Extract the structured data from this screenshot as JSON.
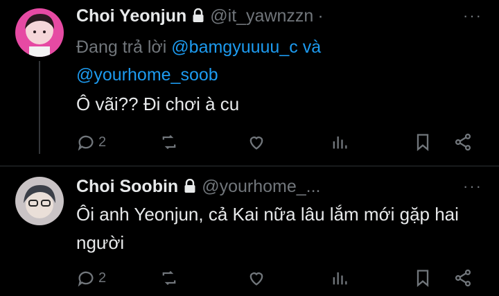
{
  "tweets": [
    {
      "name": "Choi Yeonjun",
      "handle": "@it_yawnzzn",
      "separator": "·",
      "more": "···",
      "reply_prefix": "Đang trả lời",
      "reply_mention_1": "@bamgyuuuu_c",
      "reply_conj": "và",
      "reply_mention_2": "@yourhome_soob",
      "text": "Ô vãi?? Đi chơi à cu",
      "reply_count": "2",
      "avatar_color": "#e64aa3"
    },
    {
      "name": "Choi Soobin",
      "handle": "@yourhome_...",
      "more": "···",
      "text": "Ôi anh Yeonjun, cả Kai nữa lâu lắm mới gặp hai người",
      "reply_count": "2",
      "avatar_color": "#c9c3c5"
    }
  ],
  "icons": [
    "lock-icon",
    "reply-icon",
    "retweet-icon",
    "like-icon",
    "views-icon",
    "bookmark-icon",
    "share-icon",
    "more-icon"
  ],
  "colors": {
    "background": "#000000",
    "text": "#e7e9ea",
    "muted": "#71767b",
    "link": "#1d9bf0"
  }
}
